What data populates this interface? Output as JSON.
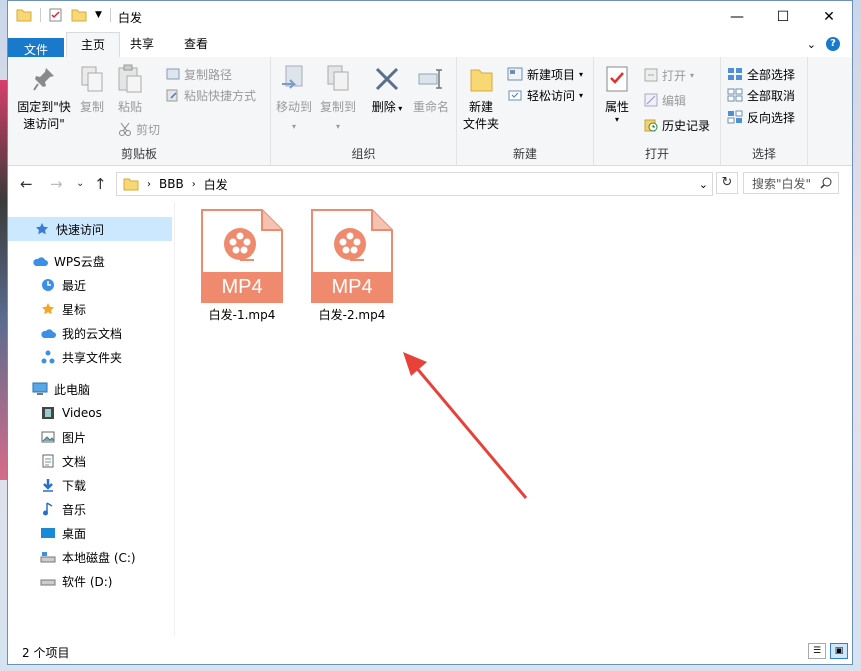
{
  "window": {
    "title": "白发"
  },
  "tabs": {
    "file": "文件",
    "home": "主页",
    "share": "共享",
    "view": "查看"
  },
  "ribbon": {
    "clipboard": {
      "pin": "固定到\"快\n速访问\"",
      "copy": "复制",
      "paste": "粘贴",
      "copy_path": "复制路径",
      "paste_shortcut": "粘贴快捷方式",
      "cut": "剪切",
      "label": "剪贴板"
    },
    "organize": {
      "move_to": "移动到",
      "copy_to": "复制到",
      "delete": "删除",
      "rename": "重命名",
      "label": "组织"
    },
    "new": {
      "new_folder": "新建\n文件夹",
      "new_item": "新建项目",
      "easy_access": "轻松访问",
      "label": "新建"
    },
    "open": {
      "properties": "属性",
      "open": "打开",
      "edit": "编辑",
      "history": "历史记录",
      "label": "打开"
    },
    "select": {
      "select_all": "全部选择",
      "select_none": "全部取消",
      "invert": "反向选择",
      "label": "选择"
    }
  },
  "address": {
    "crumbs": [
      "BBB",
      "白发"
    ],
    "search_placeholder": "搜索\"白发\""
  },
  "sidebar": {
    "items": [
      {
        "label": "快速访问",
        "icon": "star-icon"
      },
      {
        "label": "WPS云盘",
        "icon": "cloud-icon"
      },
      {
        "label": "最近",
        "icon": "clock-icon"
      },
      {
        "label": "星标",
        "icon": "star-icon"
      },
      {
        "label": "我的云文档",
        "icon": "cloud-icon"
      },
      {
        "label": "共享文件夹",
        "icon": "share-icon"
      },
      {
        "label": "此电脑",
        "icon": "computer-icon"
      },
      {
        "label": "Videos",
        "icon": "video-icon"
      },
      {
        "label": "图片",
        "icon": "picture-icon"
      },
      {
        "label": "文档",
        "icon": "document-icon"
      },
      {
        "label": "下载",
        "icon": "download-icon"
      },
      {
        "label": "音乐",
        "icon": "music-icon"
      },
      {
        "label": "桌面",
        "icon": "desktop-icon"
      },
      {
        "label": "本地磁盘 (C:)",
        "icon": "drive-icon"
      },
      {
        "label": "软件 (D:)",
        "icon": "drive-icon"
      }
    ]
  },
  "files": [
    {
      "name": "白发-1.mp4",
      "badge": "MP4"
    },
    {
      "name": "白发-2.mp4",
      "badge": "MP4"
    }
  ],
  "status": {
    "count": "2 个项目"
  },
  "colors": {
    "accent": "#1979ca",
    "file_icon": "#f08a6e",
    "arrow": "#e8413a"
  }
}
